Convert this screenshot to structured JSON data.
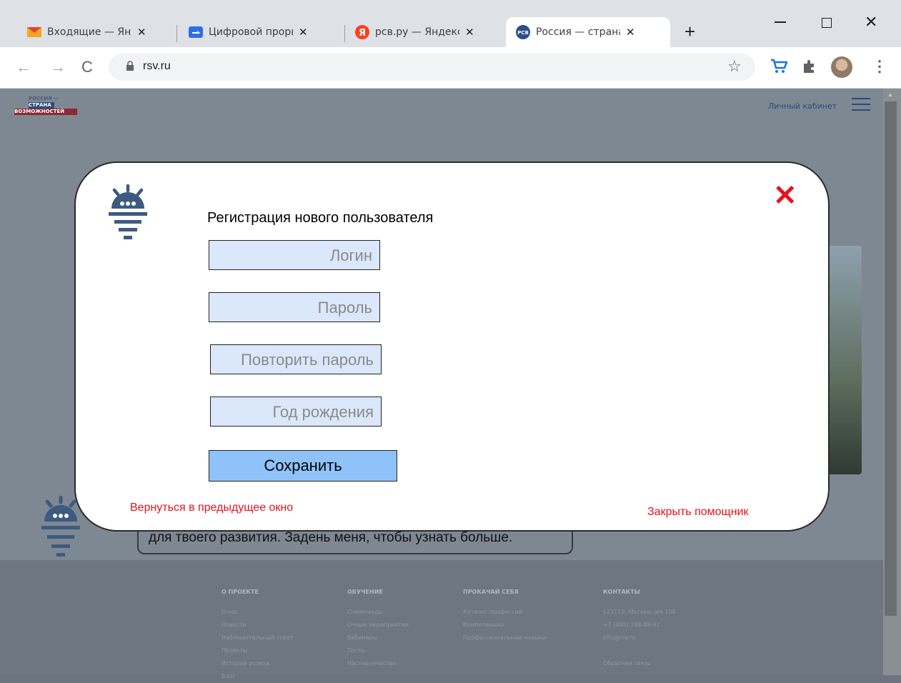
{
  "browser": {
    "tabs": [
      {
        "title": "Входящие — Янд",
        "icon": "mail-icon"
      },
      {
        "title": "Цифровой проры",
        "icon": "chat-icon"
      },
      {
        "title": "рсв.ру — Яндекс",
        "icon": "yandex-icon"
      },
      {
        "title": "Россия — страна",
        "icon": "rsv-icon"
      }
    ],
    "url": "rsv.ru"
  },
  "site": {
    "logo_lines": [
      "РОССИЯ —",
      "СТРАНА",
      "ВОЗМОЖНОСТЕЙ"
    ],
    "cabinet_link": "Личный кабинет"
  },
  "assistant_bubble": {
    "text": "для твоего развития. Задень меня, чтобы узнать больше."
  },
  "footer": {
    "columns": [
      {
        "heading": "О ПРОЕКТЕ",
        "items": [
          "О нас",
          "Новости",
          "Наблюдательный совет",
          "Проекты",
          "Истории успеха",
          "Блог"
        ]
      },
      {
        "heading": "ОБУЧЕНИЕ",
        "items": [
          "Олимпиады",
          "Очные мероприятия",
          "Вебинары",
          "Тесты",
          "Наставничество"
        ]
      },
      {
        "heading": "ПРОКАЧАЙ СЕБЯ",
        "items": [
          "Каталог профессий",
          "Компетенции",
          "Профессиональные навыки"
        ]
      },
      {
        "heading": "КОНТАКТЫ",
        "items": [
          "123112, Москва, а/я 100",
          "+7 (495) 198-88-92",
          "info@rsv.ru",
          "",
          "Обратная связь"
        ]
      }
    ]
  },
  "modal": {
    "title": "Регистрация нового пользователя",
    "login_placeholder": "Логин",
    "password_placeholder": "Пароль",
    "repeat_password_placeholder": "Повторить пароль",
    "birth_year_placeholder": "Год рождения",
    "save_label": "Сохранить",
    "back_label": "Вернуться в предыдущее окно",
    "close_label": "Закрыть помощник",
    "close_x": "✕"
  },
  "colors": {
    "accent_red": "#e8111e",
    "field_bg": "#dbe7fb",
    "button_bg": "#8fc2f8",
    "logo_blue": "#3d5a80"
  }
}
